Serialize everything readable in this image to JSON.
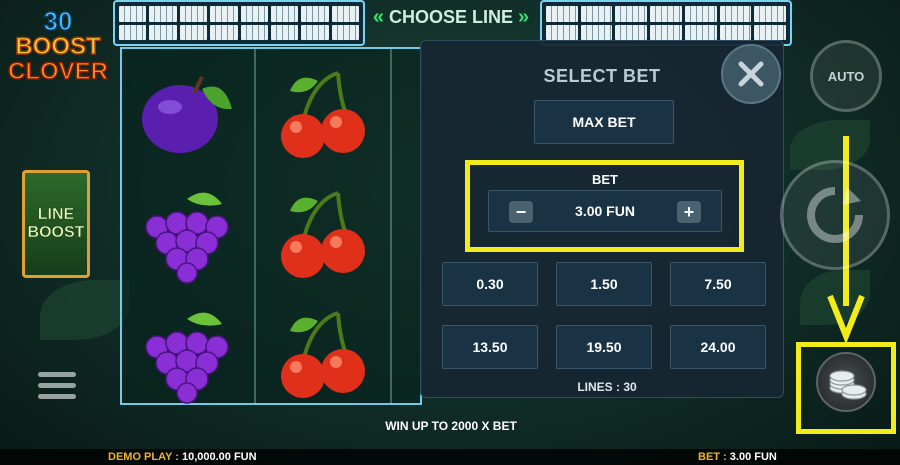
{
  "logo": {
    "line1": "30",
    "line2": "BOOST",
    "line3": "CLOVER"
  },
  "line_boost": {
    "label": "LINE BOOST"
  },
  "choose_line": {
    "label": "CHOOSE LINE"
  },
  "reels": {
    "columns": [
      [
        "plum-icon",
        "grapes-icon",
        "grapes-icon"
      ],
      [
        "cherries-icon",
        "cherries-icon",
        "cherries-icon"
      ]
    ]
  },
  "select_bet": {
    "title": "SELECT BET",
    "max_bet": "MAX BET",
    "bet_label": "BET",
    "current_bet": "3.00 FUN",
    "presets": [
      "0.30",
      "1.50",
      "7.50",
      "13.50",
      "19.50",
      "24.00"
    ],
    "lines": "LINES : 30"
  },
  "controls": {
    "auto": "AUTO"
  },
  "win_text": "WIN UP TO 2000 X BET",
  "footer": {
    "demo_label": "DEMO PLAY :",
    "demo_value": "10,000.00 FUN",
    "bet_label": "BET :",
    "bet_value": "3.00 FUN"
  },
  "colors": {
    "highlight": "#f2ec1b",
    "accent_green": "#35e06e",
    "reel_border": "#75c8e8"
  }
}
